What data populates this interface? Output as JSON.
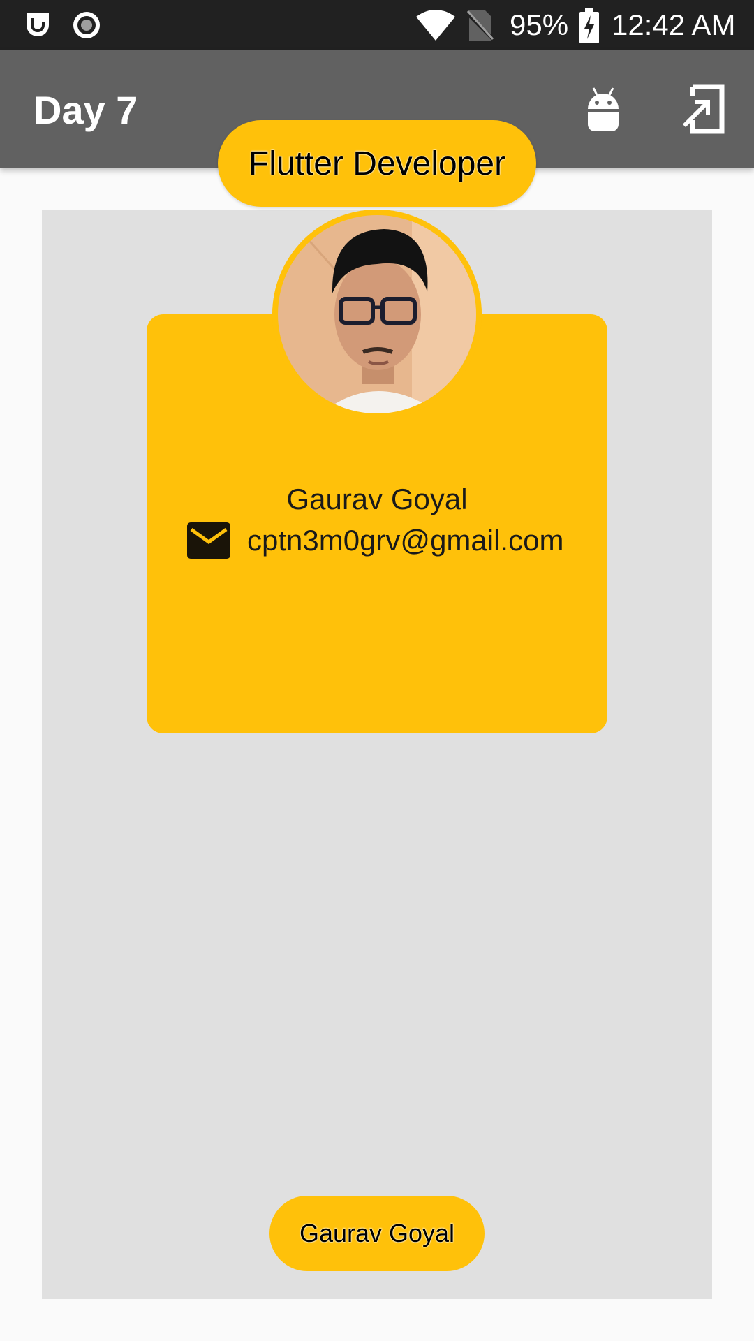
{
  "status_bar": {
    "battery": "95%",
    "time": "12:42 AM",
    "icons": [
      "notification-app-icon",
      "record-icon",
      "wifi-icon",
      "no-sim-icon",
      "battery-charging-icon"
    ]
  },
  "app_bar": {
    "title": "Day 7",
    "actions": [
      "android-icon",
      "exit-to-app-icon"
    ]
  },
  "profile": {
    "role_chip": "Flutter Developer",
    "name": "Gaurav Goyal",
    "email": "cptn3m0grv@gmail.com",
    "footer_chip": "Gaurav Goyal"
  },
  "colors": {
    "accent": "#FFC10A",
    "app_bar": "#616161",
    "status_bar": "#212121",
    "panel": "#E0E0E0",
    "background": "#FAFAFA"
  }
}
